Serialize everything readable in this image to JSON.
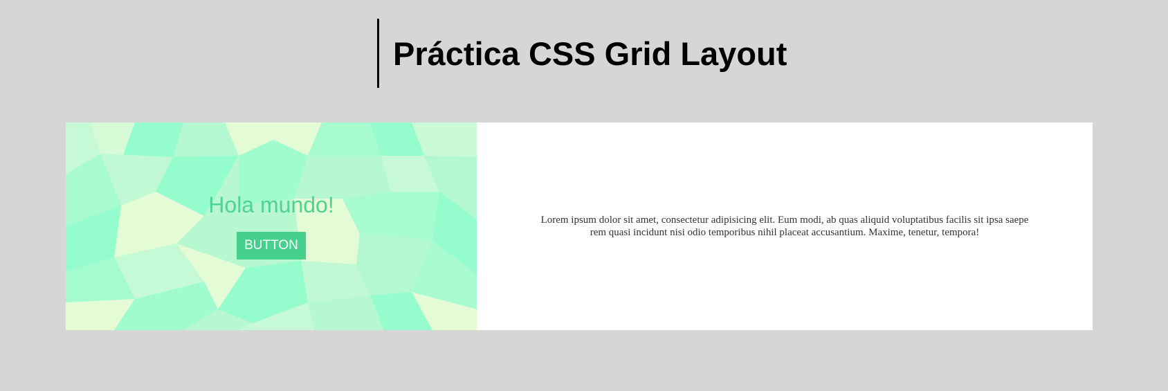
{
  "header": {
    "title": "Práctica CSS Grid Layout"
  },
  "hero": {
    "heading": "Hola mundo!",
    "button_label": "BUTTON"
  },
  "content": {
    "paragraph": "Lorem ipsum dolor sit amet, consectetur adipisicing elit. Eum modi, ab quas aliquid voluptatibus facilis sit ipsa saepe rem quasi incidunt nisi odio temporibus nihil placeat accusantium. Maxime, tenetur, tempora!"
  },
  "colors": {
    "page_background": "#d6d6d6",
    "accent_green": "#45d18d",
    "heading_green": "#4dd494",
    "pattern_mint": "#95fcce",
    "pattern_pale": "#e4fcd6",
    "pattern_light": "#b5f7cf"
  }
}
